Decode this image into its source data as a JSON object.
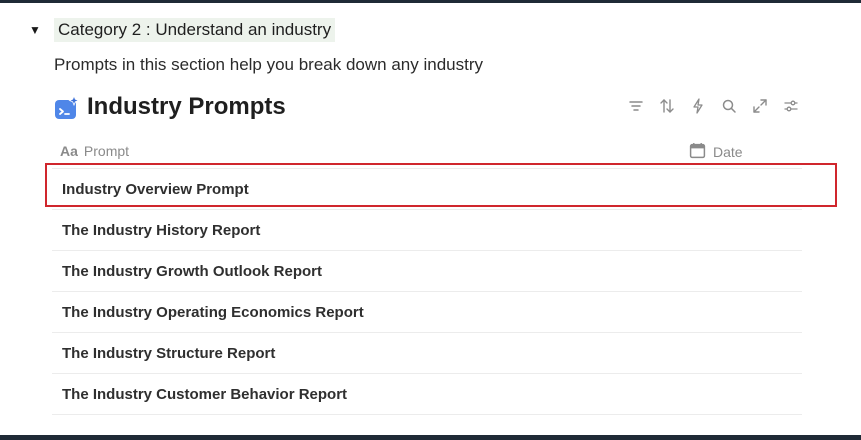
{
  "toggle": {
    "arrow": "▼",
    "title": "Category 2 : Understand  an industry",
    "background": "#edf3ec"
  },
  "section": {
    "description": "Prompts in this section help you break down any industry"
  },
  "database": {
    "icon": "database-sparkle-icon",
    "title": "Industry Prompts",
    "tools": [
      "filter-icon",
      "sort-icon",
      "automation-icon",
      "search-icon",
      "expand-icon",
      "settings-icon"
    ]
  },
  "table": {
    "columns": [
      {
        "label": "Prompt",
        "icon": "text-property-icon",
        "glyph": "Aa"
      },
      {
        "label": "Date",
        "icon": "calendar-icon"
      }
    ],
    "rows": [
      "Industry Overview Prompt",
      "The Industry History Report",
      "The Industry Growth Outlook Report",
      "The Industry Operating Economics Report",
      "The Industry Structure Report",
      "The Industry Customer Behavior Report"
    ],
    "highlighted_row": 0,
    "highlight_color": "#d0262d"
  }
}
